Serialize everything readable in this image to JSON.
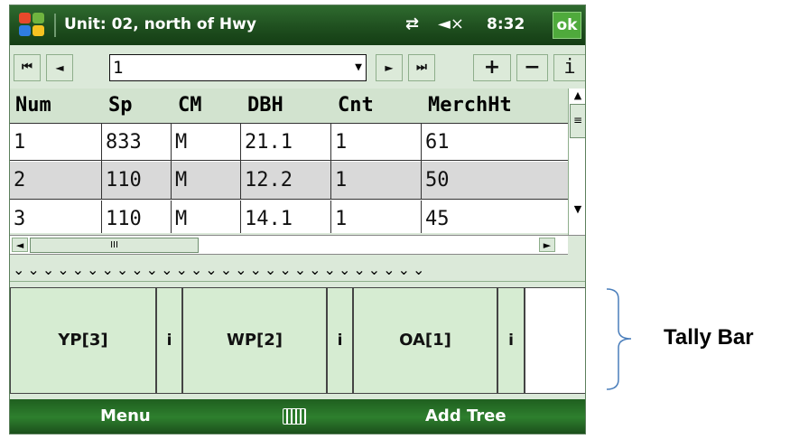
{
  "title_bar": {
    "title": "Unit: 02, north of Hwy",
    "clock": "8:32",
    "ok_label": "ok",
    "icons": [
      "windows-start-icon",
      "connectivity-icon",
      "volume-muted-icon"
    ]
  },
  "toolbar": {
    "first_label": "⏮",
    "prev_label": "◄",
    "record_value": "1",
    "next_label": "►",
    "last_label": "⏭",
    "add_label": "+",
    "remove_label": "−",
    "info_label": "i"
  },
  "grid": {
    "columns": [
      "Num",
      "Sp",
      "CM",
      "DBH",
      "Cnt",
      "MerchHt"
    ],
    "rows": [
      [
        "1",
        "833",
        "M",
        "21.1",
        "1",
        "61"
      ],
      [
        "2",
        "110",
        "M",
        "12.2",
        "1",
        "50"
      ],
      [
        "3",
        "110",
        "M",
        "14.1",
        "1",
        "45"
      ]
    ]
  },
  "scrollbars": {
    "h_thumb_grip": "III"
  },
  "chevron_strip": "⌄⌄⌄⌄⌄⌄⌄⌄⌄⌄⌄⌄⌄⌄⌄⌄⌄⌄⌄⌄⌄⌄⌄⌄⌄⌄⌄⌄",
  "tally_bar": {
    "buttons": [
      {
        "label": "YP[3]",
        "info": "i"
      },
      {
        "label": "WP[2]",
        "info": "i"
      },
      {
        "label": "OA[1]",
        "info": "i"
      }
    ]
  },
  "menu_bar": {
    "left_label": "Menu",
    "right_label": "Add Tree"
  },
  "annotation": {
    "label": "Tally Bar"
  },
  "colors": {
    "title_bar": "#1f4f1f",
    "panel": "#dbe9d9",
    "tally_button": "#d6ecd2",
    "ok_button": "#4faa3c",
    "selected_row": "#d9d9d9"
  }
}
